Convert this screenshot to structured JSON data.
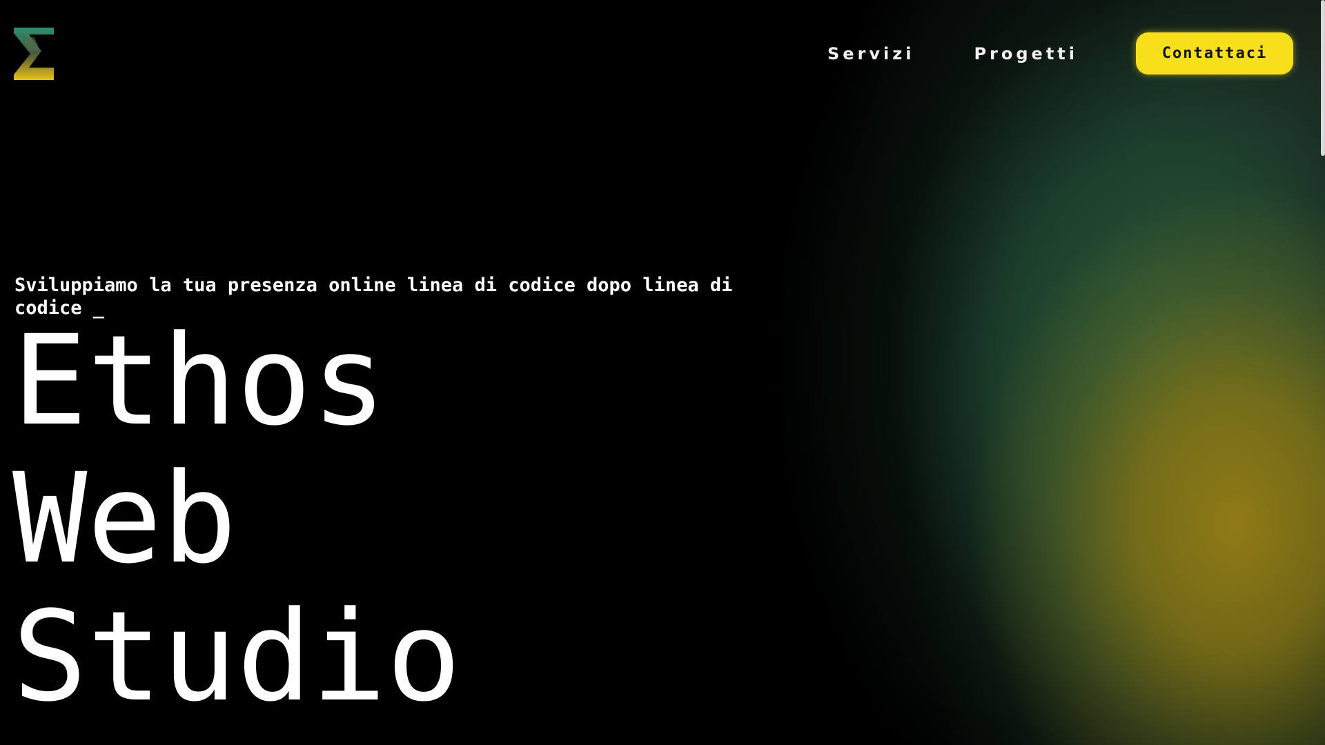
{
  "brand": {
    "logo_icon": "sigma-logo-icon",
    "colors": {
      "green": "#2e8b6a",
      "yellow": "#e8c21a",
      "dark": "#3a4a2a"
    }
  },
  "nav": {
    "items": [
      {
        "label": "Servizi"
      },
      {
        "label": "Progetti"
      }
    ],
    "cta_label": "Contattaci",
    "cta_color": "#f7df1c"
  },
  "hero": {
    "tagline": "Sviluppiamo la tua presenza online linea di codice dopo linea di codice _",
    "title_lines": [
      "Ethos",
      "Web",
      "Studio"
    ]
  },
  "theme": {
    "background": "#000000",
    "glow_green": "#245c3e",
    "glow_yellow": "#967d14"
  }
}
